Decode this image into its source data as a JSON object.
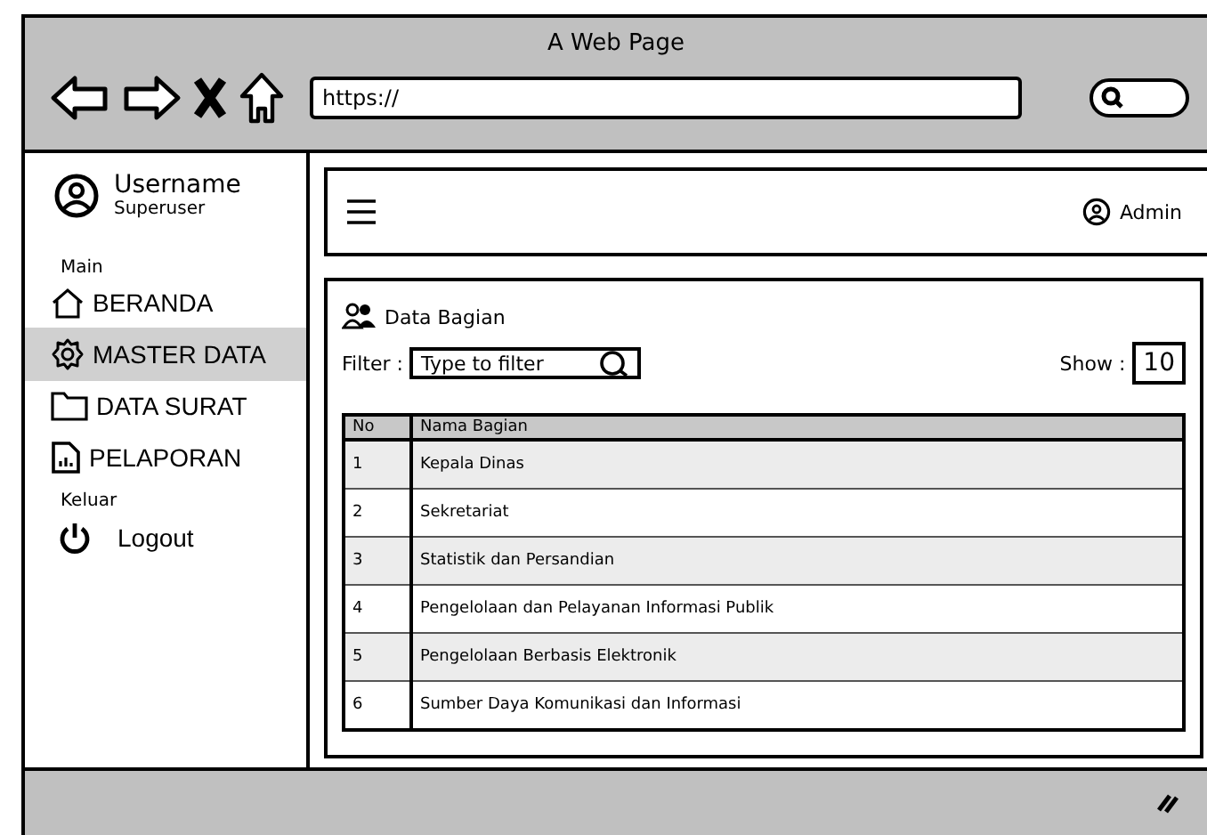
{
  "window": {
    "title": "A Web Page"
  },
  "browser": {
    "url": "https://"
  },
  "user": {
    "name": "Username",
    "role": "Superuser"
  },
  "sidebar": {
    "sections": [
      {
        "label": "Main",
        "items": [
          {
            "label": "BERANDA",
            "selected": false
          },
          {
            "label": "MASTER DATA",
            "selected": true
          },
          {
            "label": "DATA SURAT",
            "selected": false
          },
          {
            "label": "PELAPORAN",
            "selected": false
          }
        ]
      },
      {
        "label": "Keluar",
        "items": [
          {
            "label": "Logout",
            "selected": false
          }
        ]
      }
    ]
  },
  "header": {
    "account": "Admin"
  },
  "panel": {
    "title": "Data Bagian",
    "filter_label": "Filter :",
    "filter_placeholder": "Type to filter",
    "show_label": "Show :",
    "show_value": "10"
  },
  "table": {
    "columns": [
      "No",
      "Nama Bagian"
    ],
    "rows": [
      [
        "1",
        "Kepala Dinas"
      ],
      [
        "2",
        "Sekretariat"
      ],
      [
        "3",
        "Statistik dan Persandian"
      ],
      [
        "4",
        "Pengelolaan dan Pelayanan Informasi Publik"
      ],
      [
        "5",
        "Pengelolaan Berbasis Elektronik"
      ],
      [
        "6",
        "Sumber Daya Komunikasi dan Informasi"
      ]
    ]
  }
}
